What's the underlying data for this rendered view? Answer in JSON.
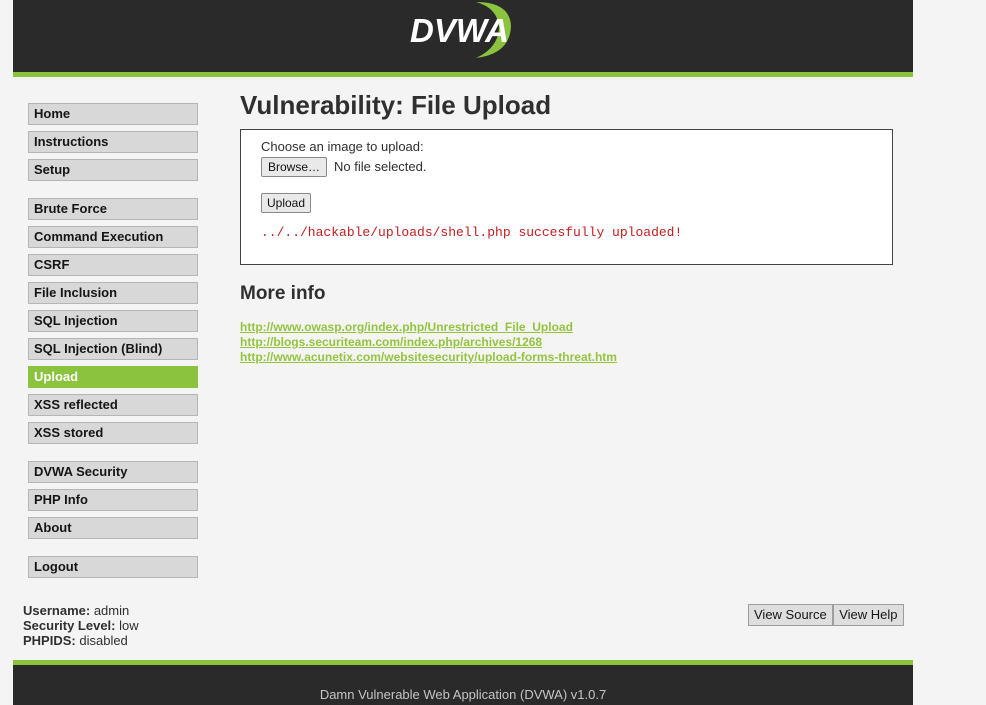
{
  "logo": {
    "text": "DVWA",
    "icon": "dvwa-swoosh-logo"
  },
  "menu": {
    "groups": [
      [
        "Home",
        "Instructions",
        "Setup"
      ],
      [
        "Brute Force",
        "Command Execution",
        "CSRF",
        "File Inclusion",
        "SQL Injection",
        "SQL Injection (Blind)",
        "Upload",
        "XSS reflected",
        "XSS stored"
      ],
      [
        "DVWA Security",
        "PHP Info",
        "About"
      ],
      [
        "Logout"
      ]
    ],
    "selected": "Upload"
  },
  "main": {
    "title": "Vulnerability: File Upload",
    "upload_label": "Choose an image to upload:",
    "browse_label": "Browse…",
    "file_status": "No file selected.",
    "upload_button": "Upload",
    "result_message": "../../hackable/uploads/shell.php succesfully uploaded!",
    "more_info_heading": "More info",
    "links": [
      "http://www.owasp.org/index.php/Unrestricted_File_Upload",
      "http://blogs.securiteam.com/index.php/archives/1268",
      "http://www.acunetix.com/websitesecurity/upload-forms-threat.htm"
    ]
  },
  "user_info": {
    "username_label": "Username:",
    "username": "admin",
    "security_label": "Security Level:",
    "security": "low",
    "phpids_label": "PHPIDS:",
    "phpids": "disabled"
  },
  "buttons": {
    "view_source": "View Source",
    "view_help": "View Help"
  },
  "footer": {
    "text": "Damn Vulnerable Web Application (DVWA) v1.0.7"
  },
  "colors": {
    "accent": "#8bc33e",
    "header": "#2a2a2a",
    "error": "#c31d1d"
  }
}
